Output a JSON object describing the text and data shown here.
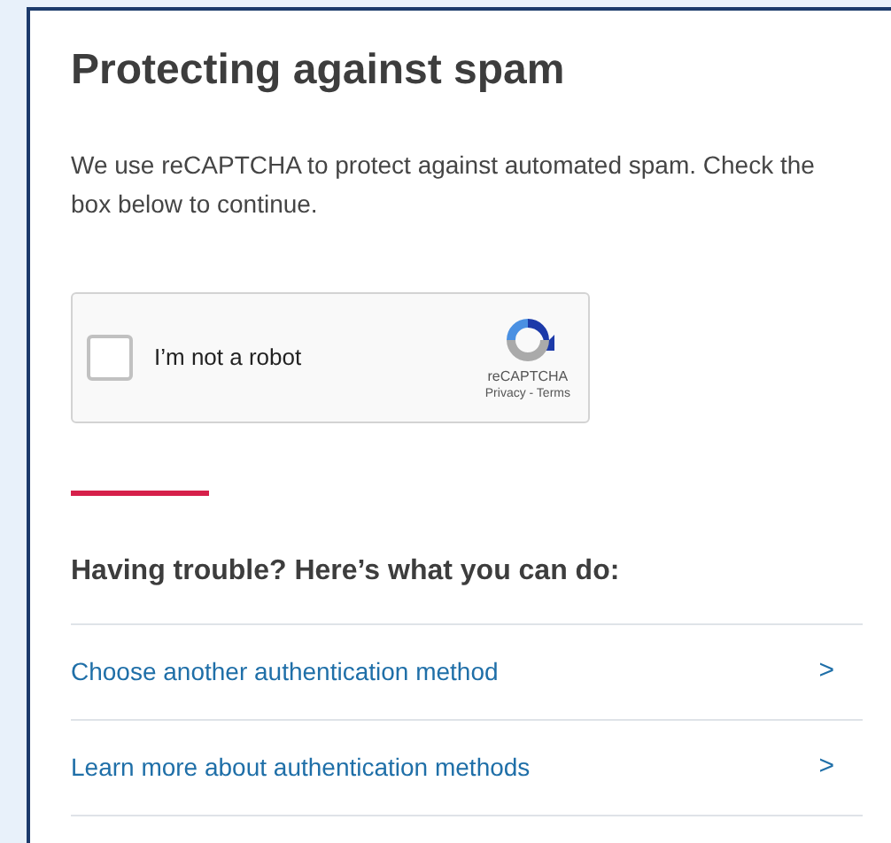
{
  "title": "Protecting against spam",
  "intro": "We use reCAPTCHA to protect against automated spam. Check the box below to continue.",
  "captcha": {
    "label": "I’m not a robot",
    "checked": false,
    "brand": "reCAPTCHA",
    "legal": "Privacy - Terms"
  },
  "help": {
    "heading": "Having trouble? Here’s what you can do:",
    "links": [
      {
        "label": "Choose another authentication method",
        "chevron": ">"
      },
      {
        "label": "Learn more about authentication methods",
        "chevron": ">"
      }
    ]
  }
}
